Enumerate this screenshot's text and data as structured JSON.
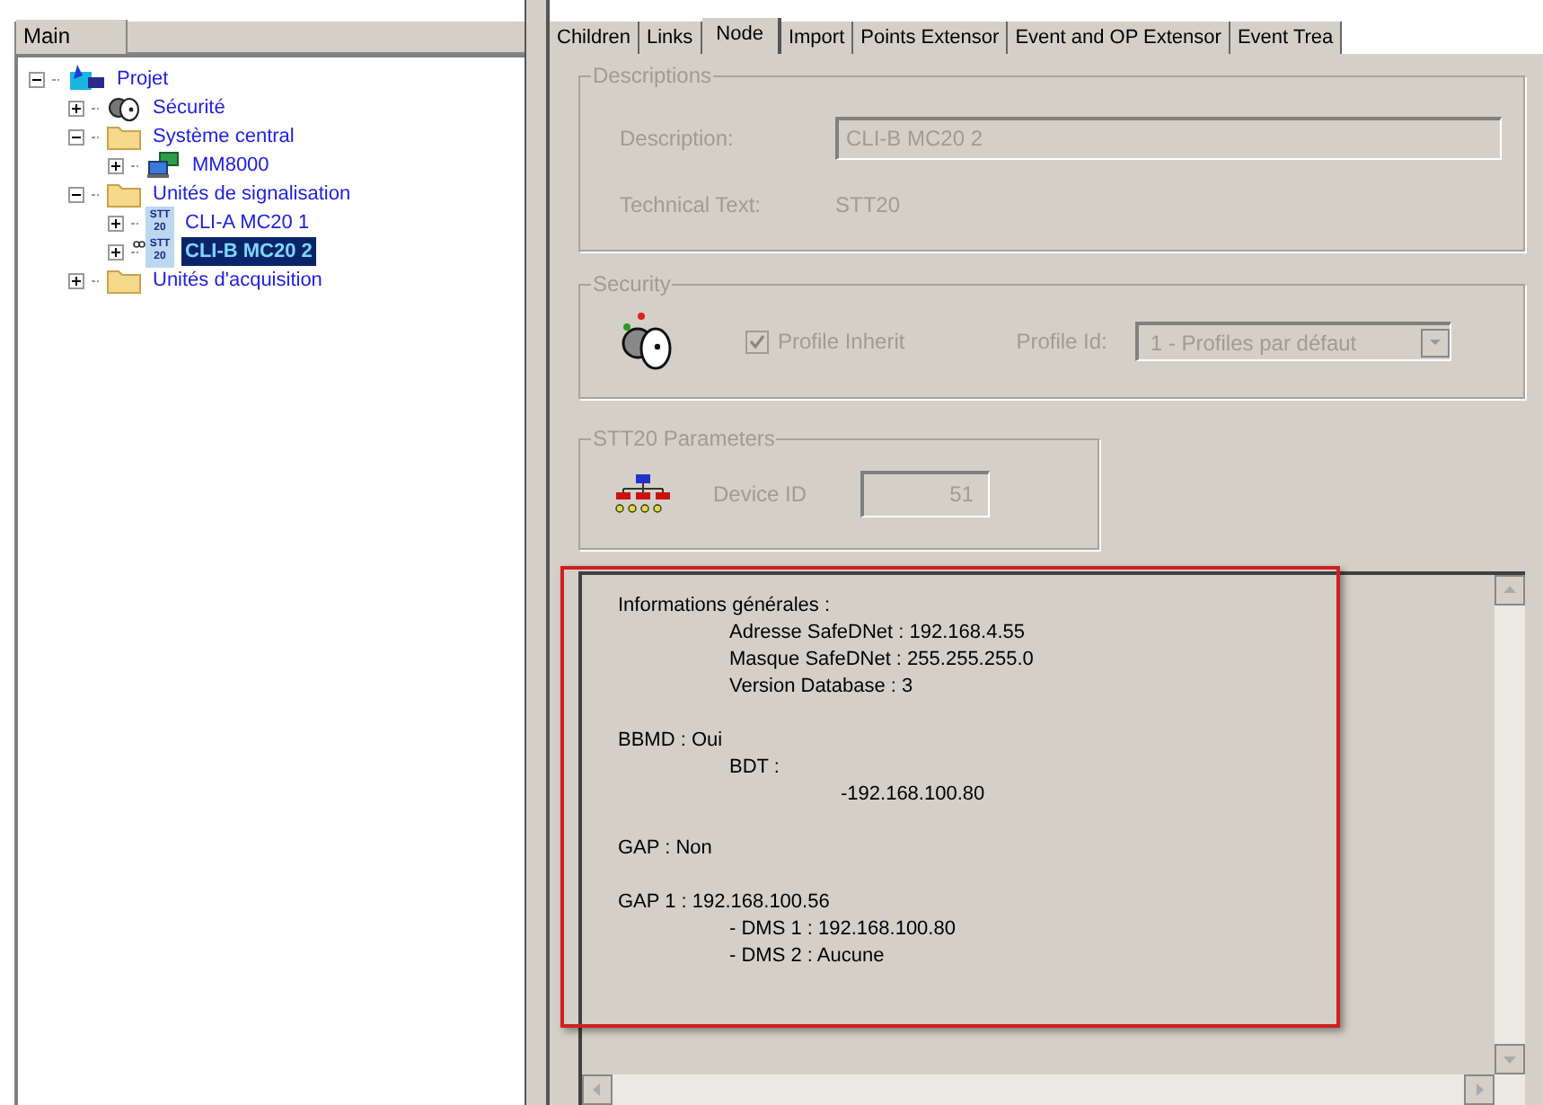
{
  "left_panel": {
    "tab": {
      "label": "Main",
      "selected": true
    },
    "tree": [
      {
        "label": "Projet",
        "kind": "project",
        "expanded": true,
        "selected": false,
        "children": [
          {
            "label": "Sécurité",
            "kind": "security",
            "expanded": false,
            "selected": false
          },
          {
            "label": "Système central",
            "kind": "folder",
            "expanded": true,
            "selected": false,
            "children": [
              {
                "label": "MM8000",
                "kind": "computer",
                "expanded": false,
                "selected": false
              }
            ]
          },
          {
            "label": "Unités de signalisation",
            "kind": "folder",
            "expanded": true,
            "selected": false,
            "children": [
              {
                "label": "CLI-A MC20 1",
                "kind": "device",
                "badge": [
                  "STT",
                  "20"
                ],
                "linked": false,
                "expanded": false,
                "selected": false
              },
              {
                "label": "CLI-B MC20 2",
                "kind": "device",
                "badge": [
                  "STT",
                  "20"
                ],
                "linked": true,
                "expanded": false,
                "selected": true
              }
            ]
          },
          {
            "label": "Unités d'acquisition",
            "kind": "folder",
            "expanded": false,
            "selected": false
          }
        ]
      }
    ]
  },
  "tabs": [
    {
      "label": "Children",
      "selected": false
    },
    {
      "label": "Links",
      "selected": false
    },
    {
      "label": "Node",
      "selected": true
    },
    {
      "label": "Import",
      "selected": false
    },
    {
      "label": "Points Extensor",
      "selected": false
    },
    {
      "label": "Event and OP Extensor",
      "selected": false
    },
    {
      "label": "Event Trea",
      "selected": false
    }
  ],
  "descriptions": {
    "title": "Descriptions",
    "description_label": "Description:",
    "description_value": "CLI-B MC20 2",
    "technical_label": "Technical Text:",
    "technical_value": "STT20",
    "disabled": true
  },
  "security": {
    "title": "Security",
    "profile_inherit": {
      "label": "Profile Inherit",
      "checked": true,
      "disabled": true
    },
    "profile_id_label": "Profile Id:",
    "profile_id_value": "1 - Profiles par défaut"
  },
  "parameters": {
    "title": "STT20 Parameters",
    "device_id_label": "Device ID",
    "device_id_value": "51"
  },
  "info": {
    "highlighted": true,
    "lines": [
      {
        "text": "Informations générales :",
        "children": [
          {
            "text": "Adresse SafeDNet : 192.168.4.55"
          },
          {
            "text": "Masque SafeDNet : 255.255.255.0"
          },
          {
            "text": "Version Database : 3"
          }
        ]
      },
      {
        "text": "BBMD : Oui",
        "children": [
          {
            "text": "BDT :",
            "children": [
              {
                "text": "-192.168.100.80"
              }
            ]
          }
        ]
      },
      {
        "text": "GAP : Non"
      },
      {
        "text": "GAP 1 : 192.168.100.56",
        "children": [
          {
            "text": "- DMS 1 : 192.168.100.80"
          },
          {
            "text": "- DMS 2 : Aucune"
          }
        ]
      }
    ]
  }
}
